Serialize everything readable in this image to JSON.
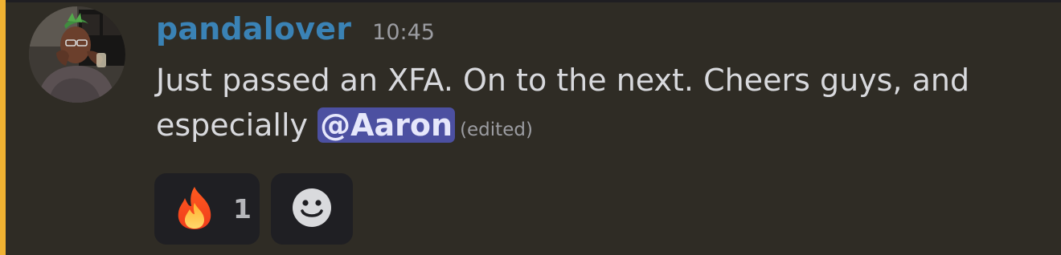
{
  "message": {
    "username": "pandalover",
    "timestamp": "10:45",
    "text_before_mention": "Just passed an XFA. On to the next. Cheers guys, and especially ",
    "mention": "@Aaron",
    "edited_label": "(edited)"
  },
  "reactions": [
    {
      "emoji": "fire-icon",
      "count": "1"
    },
    {
      "emoji": "add-reaction-smiley-icon"
    }
  ],
  "colors": {
    "username": "#3a82b5",
    "mention_bg": "#4c50a1",
    "mention_highlight_bar": "#f0b232",
    "background": "#2f2c25",
    "reaction_bg": "#1f1f23"
  }
}
